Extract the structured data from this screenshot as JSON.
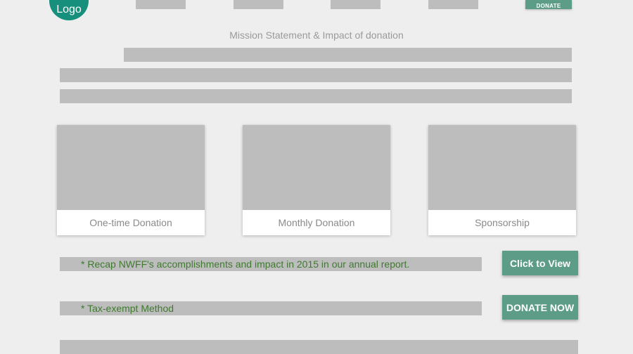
{
  "header": {
    "logo_text": "Logo",
    "donate_label": "DONATE"
  },
  "mission": {
    "heading": "Mission Statement & Impact of donation"
  },
  "cards": [
    {
      "label": "One-time Donation"
    },
    {
      "label": "Monthly Donation"
    },
    {
      "label": "Sponsorship"
    }
  ],
  "report": {
    "text": "* Recap NWFF's accomplishments and impact in 2015 in our annual report.",
    "button_label": "Click to View"
  },
  "tax": {
    "text": "* Tax-exempt Method",
    "button_label": "DONATE NOW"
  },
  "colors": {
    "brand_green": "#16907c",
    "button_green": "#5d9c86",
    "placeholder_gray": "#bdbdbd",
    "note_text_green": "#3e7a2e",
    "background": "#eeeeee"
  }
}
